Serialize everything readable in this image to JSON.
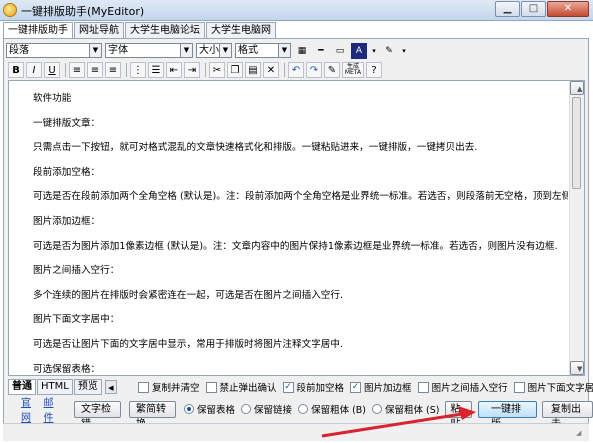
{
  "window": {
    "title": "一键排版助手(MyEditor)",
    "controls": [
      "minimize",
      "maximize",
      "close"
    ]
  },
  "tabs": [
    {
      "label": "一键排版助手",
      "active": true
    },
    {
      "label": "网址导航",
      "active": false
    },
    {
      "label": "大学生电脑论坛",
      "active": false
    },
    {
      "label": "大学生电脑网",
      "active": false
    }
  ],
  "toolbar": {
    "paragraph_select": "段落",
    "font_select": "字体",
    "size_select": "大小",
    "format_select": "格式"
  },
  "format_toolbar": {
    "bold": "B",
    "italic": "I",
    "underline": "U",
    "meta_label": "生成META"
  },
  "content": {
    "paragraphs": [
      "软件功能",
      "一键排版文章：",
      "只需点击一下按钮，就可对格式混乱的文章快速格式化和排版。一键粘贴进来，一键排版，一键拷贝出去.",
      "段前添加空格：",
      "可选是否在段前添加两个全角空格 (默认是)。注：段前添加两个全角空格是业界统一标准。若选否，则段落前无空格，顶到左侧.",
      "图片添加边框：",
      "可选是否为图片添加1像素边框 (默认是)。注：文章内容中的图片保持1像素边框是业界统一标准。若选否，则图片没有边框.",
      "图片之间插入空行：",
      "多个连续的图片在排版时会紧密连在一起，可选是否在图片之间插入空行.",
      "图片下面文字居中：",
      "可选是否让图片下面的文字居中显示，常用于排版时将图片注释文字居中.",
      "可选保留表格："
    ]
  },
  "bottom_tabs": [
    {
      "label": "普通",
      "active": true
    },
    {
      "label": "HTML",
      "active": false
    },
    {
      "label": "预览",
      "active": false
    }
  ],
  "options": [
    {
      "label": "复制并清空",
      "checked": false
    },
    {
      "label": "禁止弹出确认",
      "checked": false
    },
    {
      "label": "段前加空格",
      "checked": true
    },
    {
      "label": "图片加边框",
      "checked": true
    },
    {
      "label": "图片之间插入空行",
      "checked": false
    },
    {
      "label": "图片下面文字居中",
      "checked": false
    }
  ],
  "actions": {
    "link_site": "官网",
    "link_mail": "邮件",
    "btn_text_check": "文字检错",
    "btn_convert": "繁简转换",
    "radio_table": "保留表格",
    "radio_link": "保留链接",
    "radio_bold": "保留粗体 (B)",
    "radio_bold2": "保留粗体 (S)",
    "btn_paste": "粘贴",
    "btn_format": "一键排版",
    "btn_copy_out": "复制出去"
  },
  "colors": {
    "accent": "#1b4f9a",
    "arrow": "#d9232f",
    "titlebar": "#c3d6ec"
  }
}
